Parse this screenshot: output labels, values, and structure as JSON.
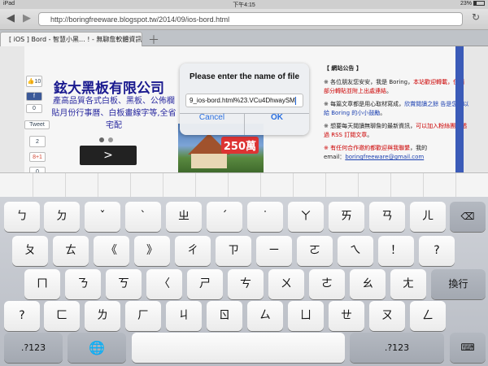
{
  "status_bar": {
    "device": "iPad",
    "time": "下午4:15",
    "battery": "23%"
  },
  "browser": {
    "back_icon": "back-arrow-icon",
    "forward_icon": "forward-arrow-icon",
    "url": "http://boringfreeware.blogspot.tw/2014/09/ios-bord.html",
    "reload_icon": "reload-icon",
    "tab_title": "[ iOS ] Bord - 智慧小黑... ! - 無聊詹軟體資訊站",
    "add_tab_icon": "plus-icon"
  },
  "web": {
    "social": {
      "like_count": "10",
      "f_label": "f",
      "tweet_label": "Tweet",
      "tweet_count": "2",
      "gplus_label": "8+1",
      "gplus_count": "0"
    },
    "ad_title": "鉉大黑板有限公司",
    "ad_text": "產高品質各式白板、黑板、公佈欄 貼月份行事曆、白板畫線字等,全省宅配",
    "next_label": ">",
    "banner_badge": "250萬",
    "notice": {
      "heading": "【 網站公告 】",
      "p1_lead": "※ 各位朋友您安安，我是 Boring，",
      "p1_hi": "本站歡迎轉載，但請部分轉貼並附上出處連結",
      "p1_end": "。",
      "p2_lead": "※ 每篇文章都是用心取材寫成，",
      "p2_hi": "欣賞閱讀之餘 告是您可以給 Boring 的小小鼓勵",
      "p2_end": "。",
      "p3_lead": "※ 想要每天閱讀無聊詹的最新資訊，",
      "p3_hi": "可以加入粉絲團或透過 RSS 訂閱文章",
      "p3_end": "。",
      "p4_hi": "※ 有任何合作邀約都歡迎與我聯繫",
      "p4_end": "，我的",
      "email_label": "email：",
      "email": "boringfreeware@gmail.com"
    }
  },
  "dialog": {
    "title": "Please enter the name of file",
    "value": "9_ios-bord.html%23.VCu4DhwaySM",
    "cancel_label": "Cancel",
    "ok_label": "OK"
  },
  "keyboard": {
    "row1": [
      "ㄅ",
      "ㄉ",
      "ˇ",
      "ˋ",
      "ㄓ",
      "ˊ",
      "˙",
      "ㄚ",
      "ㄞ",
      "ㄢ",
      "ㄦ"
    ],
    "backspace_icon": "backspace-icon",
    "row2": [
      "ㄆ",
      "ㄊ",
      "《",
      "》",
      "ㄔ",
      "ㄗ",
      "ㄧ",
      "ㄛ",
      "ㄟ",
      "！",
      "?"
    ],
    "row3": [
      "ㄇ",
      "ㄋ",
      "ㄎ",
      "〈",
      "ㄕ",
      "ㄘ",
      "ㄨ",
      "ㄜ",
      "ㄠ",
      "ㄤ"
    ],
    "enter_label": "換行",
    "row4": [
      "?",
      "ㄈ",
      "ㄌ",
      "ㄏ",
      "ㄐ",
      "ㄖ",
      "ㄙ",
      "ㄩ",
      "ㄝ",
      "ㄡ",
      "ㄥ"
    ],
    "mode_label": ".?123",
    "globe_icon": "globe-icon",
    "hide_icon": "keyboard-hide-icon"
  }
}
